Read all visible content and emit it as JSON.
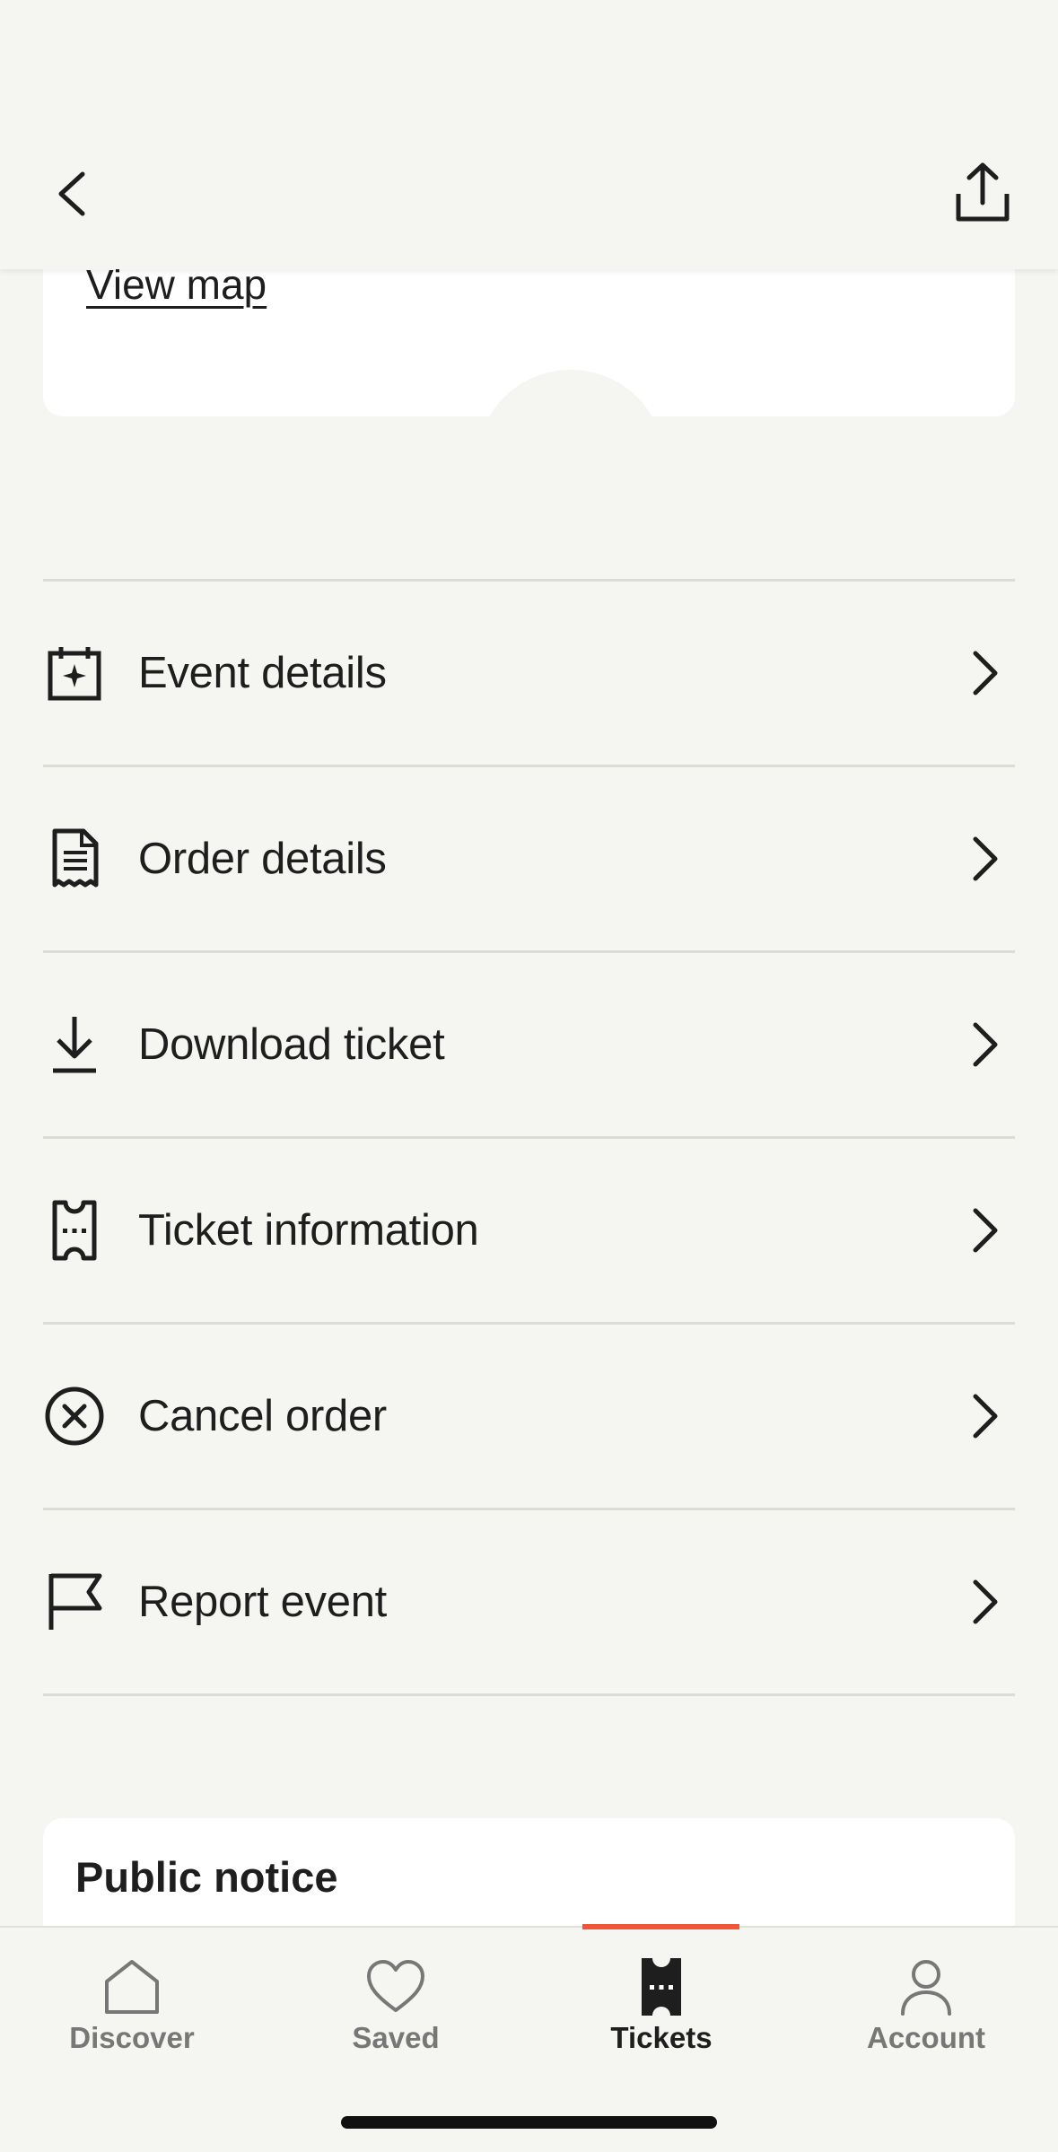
{
  "map_card": {
    "view_map_label": "View map"
  },
  "menu": {
    "items": [
      {
        "label": "Event details",
        "icon": "calendar-sparkle-icon"
      },
      {
        "label": "Order details",
        "icon": "receipt-icon"
      },
      {
        "label": "Download ticket",
        "icon": "download-icon"
      },
      {
        "label": "Ticket information",
        "icon": "ticket-icon"
      },
      {
        "label": "Cancel order",
        "icon": "cancel-circle-icon"
      },
      {
        "label": "Report event",
        "icon": "flag-icon"
      }
    ]
  },
  "notice": {
    "title": "Public notice"
  },
  "tabbar": {
    "tabs": [
      {
        "label": "Discover",
        "icon": "home-icon",
        "active": false
      },
      {
        "label": "Saved",
        "icon": "heart-icon",
        "active": false
      },
      {
        "label": "Tickets",
        "icon": "ticket-icon",
        "active": true
      },
      {
        "label": "Account",
        "icon": "person-icon",
        "active": false
      }
    ]
  },
  "colors": {
    "accent": "#f05537",
    "background": "#f5f5f1",
    "card": "#ffffff",
    "text": "#1e1e1e"
  }
}
